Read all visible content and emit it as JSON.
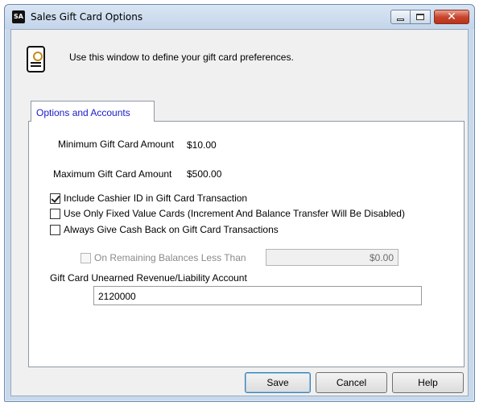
{
  "window": {
    "title": "Sales Gift Card Options",
    "app_badge": "SA",
    "close_glyph": "✕",
    "icons": {
      "app": "app-logo-icon",
      "header": "document-gear-icon"
    }
  },
  "header": {
    "text": "Use this window to define your gift card preferences."
  },
  "tabs": [
    {
      "label": "Options and Accounts",
      "selected": true
    }
  ],
  "options": {
    "min_label": "Minimum Gift Card Amount",
    "min_value": "$10.00",
    "max_label": "Maximum Gift Card Amount",
    "max_value": "$500.00",
    "checkboxes": [
      {
        "label": "Include Cashier ID in Gift Card Transaction",
        "checked": true
      },
      {
        "label": "Use Only Fixed Value Cards (Increment And Balance Transfer Will Be Disabled)",
        "checked": false
      },
      {
        "label": "Always Give Cash Back on Gift Card Transactions",
        "checked": false
      }
    ],
    "remaining": {
      "label": "On Remaining Balances Less Than",
      "value": "$0.00",
      "enabled": false
    },
    "account_label": "Gift Card Unearned Revenue/Liability Account",
    "account_value": "2120000"
  },
  "buttons": {
    "save": "Save",
    "cancel": "Cancel",
    "help": "Help"
  },
  "colors": {
    "tab_text": "#1a1ac9",
    "close_button": "#c9452e",
    "title_bar": "#c4d5ea"
  }
}
